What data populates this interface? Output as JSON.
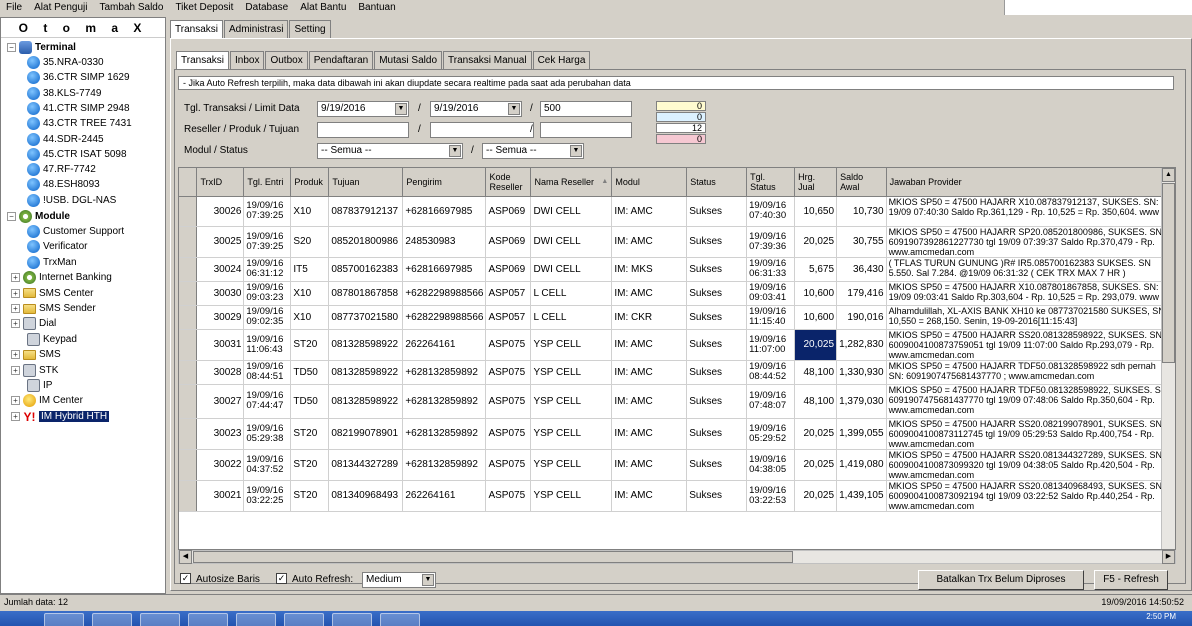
{
  "menu": [
    "File",
    "Alat Penguji",
    "Tambah Saldo",
    "Tiket Deposit",
    "Database",
    "Alat Bantu",
    "Bantuan"
  ],
  "sidebar": {
    "title": "O t o m a X",
    "terminal_label": "Terminal",
    "terminals": [
      "35.NRA-0330",
      "36.CTR SIMP 1629",
      "38.KLS-7749",
      "41.CTR SIMP 2948",
      "43.CTR TREE 7431",
      "44.SDR-2445",
      "45.CTR ISAT 5098",
      "47.RF-7742",
      "48.ESH8093",
      "!USB. DGL-NAS"
    ],
    "module_label": "Module",
    "modules": [
      "Customer Support",
      "Verificator",
      "TrxMan",
      "Internet Banking",
      "SMS Center",
      "SMS Sender",
      "Dial",
      "Keypad",
      "SMS",
      "STK",
      "IP",
      "IM Center",
      "IM Hybrid HTH"
    ]
  },
  "top_tabs": [
    "Transaksi",
    "Administrasi",
    "Setting"
  ],
  "sub_tabs": [
    "Transaksi",
    "Inbox",
    "Outbox",
    "Pendaftaran",
    "Mutasi Saldo",
    "Transaksi Manual",
    "Cek Harga"
  ],
  "info_text": "- Jika Auto Refresh terpilih, maka data dibawah ini akan diupdate secara realtime pada saat ada perubahan data",
  "form": {
    "label_tgl": "Tgl. Transaksi / Limit Data",
    "label_reseller": "Reseller / Produk / Tujuan",
    "label_modul": "Modul / Status",
    "date_from": "9/19/2016",
    "date_to": "9/19/2016",
    "limit": "500",
    "modul_value": "-- Semua --",
    "status_value": "-- Semua --",
    "separator": "/"
  },
  "counters": [
    {
      "value": "0",
      "color": "#fffbd0"
    },
    {
      "value": "0",
      "color": "#dcf1ff"
    },
    {
      "value": "12",
      "color": "#ffffff"
    },
    {
      "value": "0",
      "color": "#f6c8d2"
    }
  ],
  "table": {
    "headers": [
      "TrxID",
      "Tgl. Entri",
      "Produk",
      "Tujuan",
      "Pengirim",
      "Kode Reseller",
      "Nama Reseller",
      "Modul",
      "Status",
      "Tgl. Status",
      "Hrg. Jual",
      "Saldo Awal",
      "Jawaban Provider"
    ],
    "sort_indicator": "▲",
    "rows": [
      {
        "trxid": "30026",
        "tgl_entri": "19/09/16 07:39:25",
        "produk": "X10",
        "tujuan": "087837912137",
        "pengirim": "+62816697985",
        "kode": "ASP069",
        "nama": "DWI CELL",
        "modul": "IM: AMC",
        "status": "Sukses",
        "tgl_status": "19/09/16 07:40:30",
        "hrg": "10,650",
        "saldo": "10,730",
        "jawaban": "MKIOS SP50 = 47500 HAJARR X10.087837912137, SUKSES. SN: 19/09 07:40:30 Saldo Rp.361,129 - Rp. 10,525 = Rp. 350,604. www"
      },
      {
        "trxid": "30025",
        "tgl_entri": "19/09/16 07:39:25",
        "produk": "S20",
        "tujuan": "085201800986",
        "pengirim": "248530983",
        "kode": "ASP069",
        "nama": "DWI CELL",
        "modul": "IM: AMC",
        "status": "Sukses",
        "tgl_status": "19/09/16 07:39:36",
        "hrg": "20,025",
        "saldo": "30,755",
        "jawaban": "MKIOS SP50 = 47500 HAJARR SP20.085201800986, SUKSES. SN 6091907392861227730 tgl 19/09 07:39:37 Saldo Rp.370,479 - Rp. www.amcmedan.com"
      },
      {
        "trxid": "30024",
        "tgl_entri": "19/09/16 06:31:12",
        "produk": "IT5",
        "tujuan": "085700162383",
        "pengirim": "+62816697985",
        "kode": "ASP069",
        "nama": "DWI CELL",
        "modul": "IM: MKS",
        "status": "Sukses",
        "tgl_status": "19/09/16 06:31:33",
        "hrg": "5,675",
        "saldo": "36,430",
        "jawaban": "( TFLAS TURUN GUNUNG )R# IR5.085700162383 SUKSES. SN 5.550. Sal 7.284. @19/09 06:31:32 ( CEK TRX MAX 7 HR )"
      },
      {
        "trxid": "30030",
        "tgl_entri": "19/09/16 09:03:23",
        "produk": "X10",
        "tujuan": "087801867858",
        "pengirim": "+6282298988566",
        "kode": "ASP057",
        "nama": "L CELL",
        "modul": "IM: AMC",
        "status": "Sukses",
        "tgl_status": "19/09/16 09:03:41",
        "hrg": "10,600",
        "saldo": "179,416",
        "jawaban": "MKIOS SP50 = 47500 HAJARR X10.087801867858, SUKSES. SN: 19/09 09:03:41 Saldo Rp.303,604 - Rp. 10,525 = Rp. 293,079. www"
      },
      {
        "trxid": "30029",
        "tgl_entri": "19/09/16 09:02:35",
        "produk": "X10",
        "tujuan": "087737021580",
        "pengirim": "+6282298988566",
        "kode": "ASP057",
        "nama": "L CELL",
        "modul": "IM: CKR",
        "status": "Sukses",
        "tgl_status": "19/09/16 11:15:40",
        "hrg": "10,600",
        "saldo": "190,016",
        "jawaban": "Alhamdulillah, XL-AXIS BANK XH10 ke 087737021580 SUKSES, SN 10,550 = 268,150. Senin, 19-09-2016[11:15:43]"
      },
      {
        "trxid": "30031",
        "tgl_entri": "19/09/16 11:06:43",
        "produk": "ST20",
        "tujuan": "081328598922",
        "pengirim": "262264161",
        "kode": "ASP075",
        "nama": "YSP CELL",
        "modul": "IM: AMC",
        "status": "Sukses",
        "tgl_status": "19/09/16 11:07:00",
        "hrg": "20,025",
        "saldo": "1,282,830",
        "jawaban": "MKIOS SP50 = 47500 HAJARR SS20.081328598922, SUKSES. SN 6009004100873759051 tgl 19/09 11:07:00 Saldo Rp.293,079 - Rp. www.amcmedan.com"
      },
      {
        "trxid": "30028",
        "tgl_entri": "19/09/16 08:44:51",
        "produk": "TD50",
        "tujuan": "081328598922",
        "pengirim": "+628132859892",
        "kode": "ASP075",
        "nama": "YSP CELL",
        "modul": "IM: AMC",
        "status": "Sukses",
        "tgl_status": "19/09/16 08:44:52",
        "hrg": "48,100",
        "saldo": "1,330,930",
        "jawaban": "MKIOS SP50 = 47500 HAJARR TDF50.081328598922 sdh pernah SN: 6091907475681437770 ; www.amcmedan.com"
      },
      {
        "trxid": "30027",
        "tgl_entri": "19/09/16 07:44:47",
        "produk": "TD50",
        "tujuan": "081328598922",
        "pengirim": "+628132859892",
        "kode": "ASP075",
        "nama": "YSP CELL",
        "modul": "IM: AMC",
        "status": "Sukses",
        "tgl_status": "19/09/16 07:48:07",
        "hrg": "48,100",
        "saldo": "1,379,030",
        "jawaban": "MKIOS SP50 = 47500 HAJARR TDF50.081328598922, SUKSES. SN 6091907475681437770 tgl 19/09 07:48:06 Saldo Rp.350,604 - Rp. www.amcmedan.com"
      },
      {
        "trxid": "30023",
        "tgl_entri": "19/09/16 05:29:38",
        "produk": "ST20",
        "tujuan": "082199078901",
        "pengirim": "+628132859892",
        "kode": "ASP075",
        "nama": "YSP CELL",
        "modul": "IM: AMC",
        "status": "Sukses",
        "tgl_status": "19/09/16 05:29:52",
        "hrg": "20,025",
        "saldo": "1,399,055",
        "jawaban": "MKIOS SP50 = 47500 HAJARR SS20.082199078901, SUKSES. SN 6009004100873112745 tgl 19/09 05:29:53 Saldo Rp.400,754 - Rp. www.amcmedan.com"
      },
      {
        "trxid": "30022",
        "tgl_entri": "19/09/16 04:37:52",
        "produk": "ST20",
        "tujuan": "081344327289",
        "pengirim": "+628132859892",
        "kode": "ASP075",
        "nama": "YSP CELL",
        "modul": "IM: AMC",
        "status": "Sukses",
        "tgl_status": "19/09/16 04:38:05",
        "hrg": "20,025",
        "saldo": "1,419,080",
        "jawaban": "MKIOS SP50 = 47500 HAJARR SS20.081344327289, SUKSES. SN 6009004100873099320 tgl 19/09 04:38:05 Saldo Rp.420,504 - Rp. www.amcmedan.com"
      },
      {
        "trxid": "30021",
        "tgl_entri": "19/09/16 03:22:25",
        "produk": "ST20",
        "tujuan": "081340968493",
        "pengirim": "262264161",
        "kode": "ASP075",
        "nama": "YSP CELL",
        "modul": "IM: AMC",
        "status": "Sukses",
        "tgl_status": "19/09/16 03:22:53",
        "hrg": "20,025",
        "saldo": "1,439,105",
        "jawaban": "MKIOS SP50 = 47500 HAJARR SS20.081340968493, SUKSES. SN 6009004100873092194 tgl 19/09 03:22:52 Saldo Rp.440,254 - Rp. www.amcmedan.com"
      }
    ]
  },
  "bottom": {
    "autosize_label": "Autosize Baris",
    "autorefresh_label": "Auto Refresh:",
    "refresh_speed": "Medium",
    "cancel_button": "Batalkan Trx Belum Diproses",
    "refresh_button": "F5 - Refresh"
  },
  "status": {
    "count": "Jumlah data: 12",
    "datetime": "19/09/2016 14:50:52"
  },
  "taskbar": {
    "clock": "2:50 PM"
  }
}
